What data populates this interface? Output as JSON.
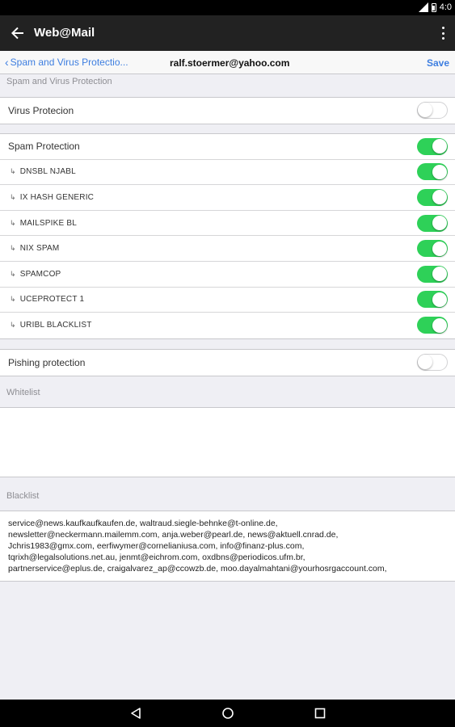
{
  "status_bar": {
    "time": "4:0"
  },
  "app_bar": {
    "title": "Web@Mail"
  },
  "nav_bar": {
    "back_label": "Spam and Virus Protectio...",
    "account": "ralf.stoermer@yahoo.com",
    "save_label": "Save"
  },
  "sections": {
    "protection_header": "Spam and Virus Protection",
    "whitelist_header": "Whitelist",
    "blacklist_header": "Blacklist"
  },
  "virus": {
    "label": "Virus Protecion",
    "enabled": false
  },
  "spam": {
    "label": "Spam Protection",
    "enabled": true,
    "lists": [
      {
        "label": "DNSBL NJABL",
        "enabled": true
      },
      {
        "label": "IX HASH GENERIC",
        "enabled": true
      },
      {
        "label": "MAILSPIKE BL",
        "enabled": true
      },
      {
        "label": "NIX SPAM",
        "enabled": true
      },
      {
        "label": "SPAMCOP",
        "enabled": true
      },
      {
        "label": "UCEPROTECT 1",
        "enabled": true
      },
      {
        "label": "URIBL BLACKLIST",
        "enabled": true
      }
    ]
  },
  "phishing": {
    "label": "Pishing protection",
    "enabled": false
  },
  "whitelist": {
    "value": ""
  },
  "blacklist": {
    "value": "service@news.kaufkaufkaufen.de, waltraud.siegle-behnke@t-online.de,\nnewsletter@neckermann.mailemm.com, anja.weber@pearl.de, news@aktuell.cnrad.de,\nJchris1983@gmx.com, eerfiwymer@cornelianiusa.com, info@finanz-plus.com,\ntqrixh@legalsolutions.net.au, jenmt@eichrom.com, oxdbns@periodicos.ufm.br,\npartnerservice@eplus.de, craigalvarez_ap@ccowzb.de, moo.dayalmahtani@yourhosrgaccount.com,"
  },
  "colors": {
    "accent": "#3d7ee0",
    "toggle_on": "#2ed158",
    "app_bar": "#222222"
  },
  "icons": {
    "back": "arrow-left-icon",
    "menu": "more-vert-icon",
    "nav_chevron": "chevron-left-icon",
    "sub_arrow": "sub-item-arrow-icon",
    "android_back": "triangle-back-icon",
    "android_home": "circle-home-icon",
    "android_recent": "square-recent-icon"
  }
}
